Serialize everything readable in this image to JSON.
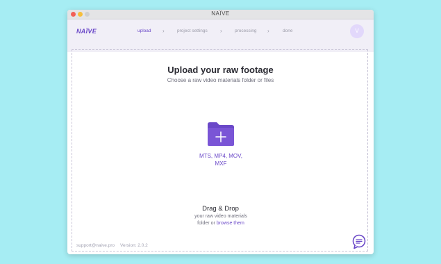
{
  "window": {
    "title": "NAÏVE"
  },
  "header": {
    "logo": "NAÏVE",
    "steps": [
      {
        "label": "upload",
        "active": true
      },
      {
        "label": "project settings",
        "active": false
      },
      {
        "label": "processing",
        "active": false
      },
      {
        "label": "done",
        "active": false
      }
    ],
    "step_separator": "›",
    "avatar_initial": "V"
  },
  "upload": {
    "title": "Upload your raw footage",
    "subtitle": "Choose a raw video materials folder or files",
    "folder_icon": "folder-plus-icon",
    "formats_line1": "MTS, MP4, MOV,",
    "formats_line2": "MXF",
    "dragdrop_title": "Drag & Drop",
    "dragdrop_line1": "your raw video materials",
    "dragdrop_line2_prefix": "folder or ",
    "dragdrop_link": "browse them"
  },
  "footer": {
    "support": "support@naive.pro",
    "version": "Version: 2.0.2",
    "chat_icon": "chat-bubble-icon"
  },
  "colors": {
    "accent": "#6a48c8",
    "background": "#a6edf3",
    "header_bg": "#f1eff7"
  }
}
